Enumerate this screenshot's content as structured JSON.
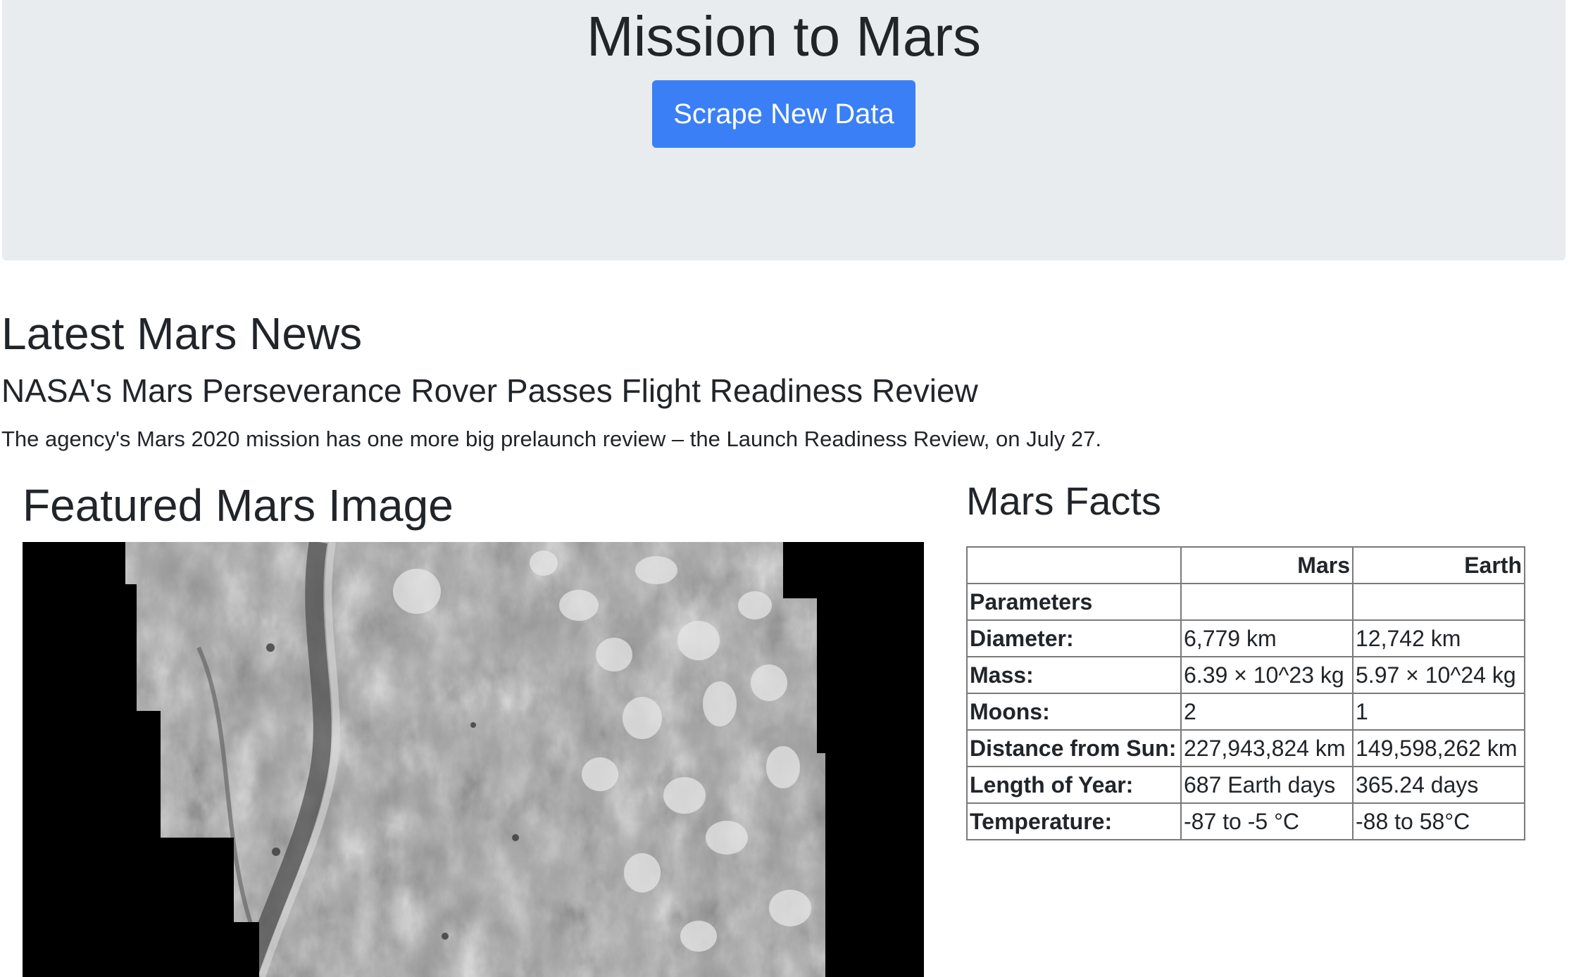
{
  "header": {
    "title": "Mission to Mars",
    "scrape_button_label": "Scrape New Data"
  },
  "news": {
    "heading": "Latest Mars News",
    "title": "NASA's Mars Perseverance Rover Passes Flight Readiness Review",
    "teaser": "The agency's Mars 2020 mission has one more big prelaunch review – the Launch Readiness Review, on July 27."
  },
  "featured_image": {
    "heading": "Featured Mars Image"
  },
  "facts": {
    "heading": "Mars Facts",
    "columns": [
      "",
      "Mars",
      "Earth"
    ],
    "index_label": "Parameters",
    "rows": [
      {
        "label": "Diameter:",
        "mars": "6,779 km",
        "earth": "12,742 km"
      },
      {
        "label": "Mass:",
        "mars": "6.39 × 10^23 kg",
        "earth": "5.97 × 10^24 kg"
      },
      {
        "label": "Moons:",
        "mars": "2",
        "earth": "1"
      },
      {
        "label": "Distance from Sun:",
        "mars": "227,943,824 km",
        "earth": "149,598,262 km"
      },
      {
        "label": "Length of Year:",
        "mars": "687 Earth days",
        "earth": "365.24 days"
      },
      {
        "label": "Temperature:",
        "mars": "-87 to -5 °C",
        "earth": "-88 to 58°C"
      }
    ]
  },
  "colors": {
    "jumbotron_bg": "#e9ecef",
    "button_bg": "#3a7ff6",
    "text": "#212529",
    "table_border": "#7a7a7a"
  }
}
